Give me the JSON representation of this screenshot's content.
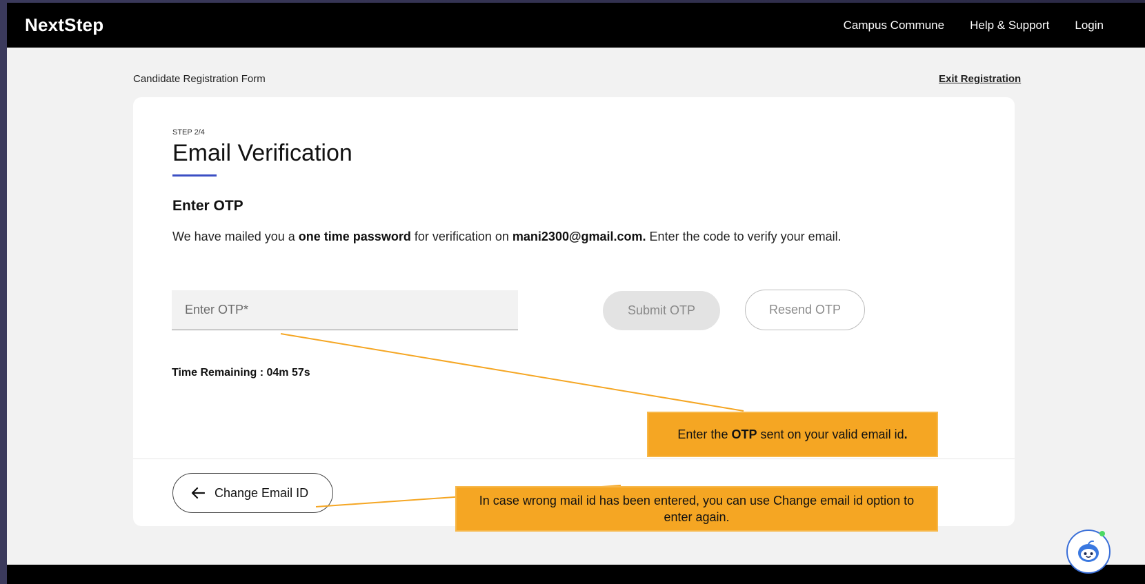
{
  "header": {
    "brand": "NextStep",
    "nav": [
      "Campus Commune",
      "Help & Support",
      "Login"
    ]
  },
  "page": {
    "form_title": "Candidate Registration Form",
    "exit_label": "Exit Registration"
  },
  "card": {
    "step": "STEP 2/4",
    "title": "Email Verification",
    "subtitle": "Enter OTP",
    "desc_1": "We have mailed you a ",
    "desc_bold_1": "one time password",
    "desc_2": " for verification on ",
    "desc_email": "mani2300@gmail.com.",
    "desc_3": " Enter the code to verify your email.",
    "otp_placeholder": "Enter OTP*",
    "otp_value": "",
    "submit_label": "Submit OTP",
    "resend_label": "Resend OTP",
    "timer": "Time Remaining : 04m 57s",
    "change_email_label": "Change Email ID"
  },
  "callouts": {
    "otp_1": "Enter the ",
    "otp_bold": "OTP",
    "otp_2": " sent on your valid email id",
    "otp_end": ".",
    "change_email": "In case wrong mail id has been entered, you can use Change email id option to enter again."
  },
  "icons": {
    "back": "arrow-left-icon",
    "chatbot": "chatbot-icon"
  },
  "colors": {
    "accent": "#3b4fc4",
    "callout": "#f5a623",
    "header_bg": "#000000"
  }
}
